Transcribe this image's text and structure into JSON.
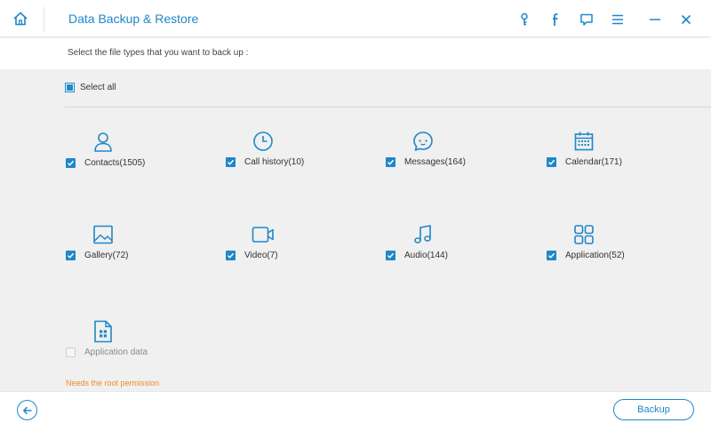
{
  "app": {
    "title": "Data Backup & Restore"
  },
  "header": {
    "instruction": "Select the file types that you want to back up :"
  },
  "select_all": {
    "label": "Select all",
    "state": "partial"
  },
  "file_types": [
    {
      "label": "Contacts(1505)",
      "checked": true,
      "icon": "contact-icon"
    },
    {
      "label": "Call history(10)",
      "checked": true,
      "icon": "clock-icon"
    },
    {
      "label": "Messages(164)",
      "checked": true,
      "icon": "message-icon"
    },
    {
      "label": "Calendar(171)",
      "checked": true,
      "icon": "calendar-icon"
    },
    {
      "label": "Gallery(72)",
      "checked": true,
      "icon": "image-icon"
    },
    {
      "label": "Video(7)",
      "checked": true,
      "icon": "video-icon"
    },
    {
      "label": "Audio(144)",
      "checked": true,
      "icon": "music-icon"
    },
    {
      "label": "Application(52)",
      "checked": true,
      "icon": "apps-icon"
    },
    {
      "label": "Application data",
      "checked": false,
      "disabled": true,
      "icon": "app-data-icon"
    }
  ],
  "root_note": "Needs the root permission",
  "footer": {
    "backup_label": "Backup"
  },
  "colors": {
    "accent": "#1e87c9",
    "warning": "#f08a24",
    "background": "#f0f0f0"
  }
}
